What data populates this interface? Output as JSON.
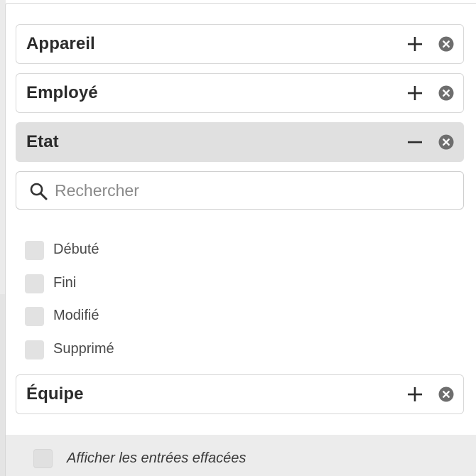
{
  "filters": [
    {
      "label": "Appareil",
      "state": "collapsed",
      "toggle_icon": "plus-icon",
      "remove_icon": "close-circle-icon"
    },
    {
      "label": "Employé",
      "state": "collapsed",
      "toggle_icon": "plus-icon",
      "remove_icon": "close-circle-icon"
    },
    {
      "label": "Etat",
      "state": "expanded",
      "toggle_icon": "minus-icon",
      "remove_icon": "close-circle-icon"
    },
    {
      "label": "Équipe",
      "state": "collapsed",
      "toggle_icon": "plus-icon",
      "remove_icon": "close-circle-icon"
    }
  ],
  "search": {
    "placeholder": "Rechercher",
    "value": "",
    "icon": "search-icon"
  },
  "etat_options": [
    {
      "label": "Débuté",
      "checked": false
    },
    {
      "label": "Fini",
      "checked": false
    },
    {
      "label": "Modifié",
      "checked": false
    },
    {
      "label": "Supprimé",
      "checked": false
    }
  ],
  "footer": {
    "show_deleted_label": "Afficher les entrées effacées",
    "show_deleted_checked": false
  },
  "colors": {
    "active_filter_bg": "#e0e0e0",
    "text": "#2b2b2b",
    "checkbox": "#e2e2e2",
    "icon": "#2b2b2b",
    "remove_icon": "#6e6e6e"
  }
}
